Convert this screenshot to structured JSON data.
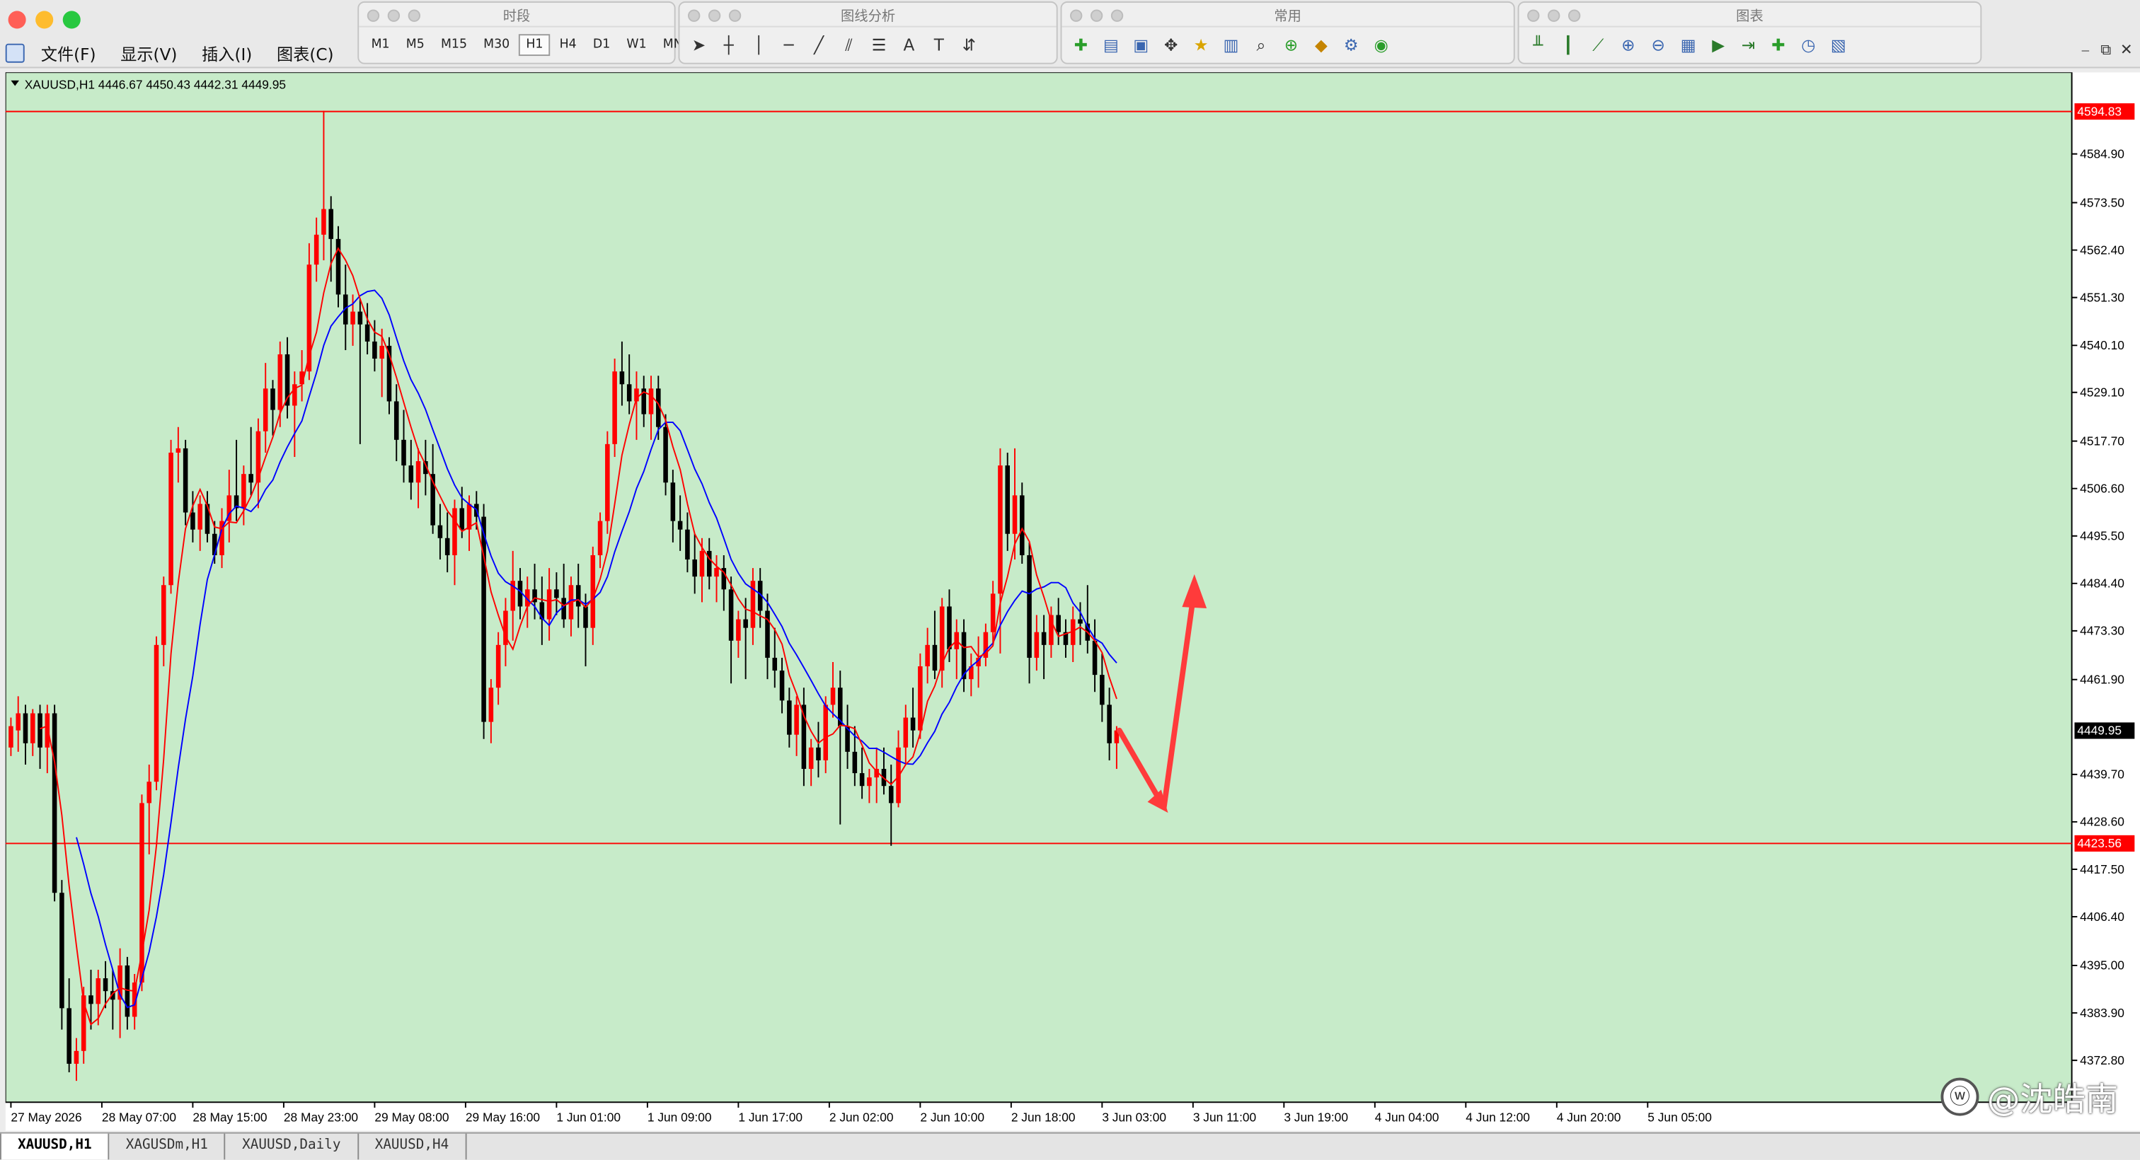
{
  "menu": {
    "items": [
      "文件(F)",
      "显示(V)",
      "插入(I)",
      "图表(C)"
    ]
  },
  "toolbars": {
    "timeframes": {
      "title": "时段",
      "items": [
        "M1",
        "M5",
        "M15",
        "M30",
        "H1",
        "H4",
        "D1",
        "W1",
        "MN"
      ],
      "active": "H1"
    },
    "line_studies": {
      "title": "图线分析"
    },
    "standard": {
      "title": "常用"
    },
    "charts": {
      "title": "图表"
    }
  },
  "window_controls": [
    "⎯",
    "⧉",
    "✕"
  ],
  "tabs": [
    {
      "label": "XAUUSD,H1",
      "active": true
    },
    {
      "label": "XAGUSDm,H1",
      "active": false
    },
    {
      "label": "XAUUSD,Daily",
      "active": false
    },
    {
      "label": "XAUUSD,H4",
      "active": false
    }
  ],
  "watermark": {
    "text": "@沈皓南",
    "icon": "weibo-icon"
  },
  "colors": {
    "background": "#c7ebc9",
    "bull": "#ff0000",
    "bear": "#000000",
    "ma_fast": "#ff0000",
    "ma_slow": "#0000ff",
    "hline": "#ff0000",
    "arrow": "#ff3b3b"
  },
  "chart_data": {
    "type": "candlestick",
    "symbol_header": "XAUUSD,H1  4446.67 4450.43 4442.31 4449.95",
    "current_price": "4449.95",
    "y_range": [
      4363.0,
      4604.0
    ],
    "y_ticks": [
      "4584.90",
      "4573.50",
      "4562.40",
      "4551.30",
      "4540.10",
      "4529.10",
      "4517.70",
      "4506.60",
      "4495.50",
      "4484.40",
      "4473.30",
      "4461.90",
      "4439.70",
      "4428.60",
      "4417.50",
      "4406.40",
      "4395.00",
      "4383.90",
      "4372.80"
    ],
    "x_labels": [
      "27 May 2026",
      "28 May 07:00",
      "28 May 15:00",
      "28 May 23:00",
      "29 May 08:00",
      "29 May 16:00",
      "1 Jun 01:00",
      "1 Jun 09:00",
      "1 Jun 17:00",
      "2 Jun 02:00",
      "2 Jun 10:00",
      "2 Jun 18:00",
      "3 Jun 03:00",
      "3 Jun 11:00",
      "3 Jun 19:00",
      "4 Jun 04:00",
      "4 Jun 12:00",
      "4 Jun 20:00",
      "5 Jun 05:00"
    ],
    "hlines": [
      {
        "price": 4594.83,
        "label": "4594.83"
      },
      {
        "price": 4423.56,
        "label": "4423.56"
      }
    ],
    "ohlc": [
      [
        4446,
        4453,
        4444,
        4451
      ],
      [
        4450,
        4458,
        4445,
        4454
      ],
      [
        4454,
        4456,
        4442,
        4447
      ],
      [
        4447,
        4455,
        4444,
        4454
      ],
      [
        4454,
        4456,
        4441,
        4446
      ],
      [
        4446,
        4456,
        4440,
        4454
      ],
      [
        4454,
        4456,
        4410,
        4412
      ],
      [
        4412,
        4415,
        4380,
        4385
      ],
      [
        4385,
        4392,
        4370,
        4372
      ],
      [
        4372,
        4378,
        4368,
        4375
      ],
      [
        4375,
        4390,
        4372,
        4388
      ],
      [
        4388,
        4394,
        4380,
        4386
      ],
      [
        4386,
        4394,
        4381,
        4392
      ],
      [
        4392,
        4396,
        4385,
        4389
      ],
      [
        4389,
        4394,
        4380,
        4387
      ],
      [
        4387,
        4399,
        4378,
        4395
      ],
      [
        4395,
        4397,
        4380,
        4383
      ],
      [
        4383,
        4393,
        4380,
        4391
      ],
      [
        4391,
        4435,
        4389,
        4433
      ],
      [
        4433,
        4442,
        4421,
        4438
      ],
      [
        4438,
        4472,
        4436,
        4470
      ],
      [
        4470,
        4486,
        4465,
        4484
      ],
      [
        4484,
        4518,
        4482,
        4515
      ],
      [
        4515,
        4521,
        4508,
        4516
      ],
      [
        4516,
        4518,
        4498,
        4501
      ],
      [
        4501,
        4506,
        4494,
        4497
      ],
      [
        4497,
        4505,
        4492,
        4503
      ],
      [
        4503,
        4506,
        4494,
        4496
      ],
      [
        4496,
        4499,
        4489,
        4491
      ],
      [
        4491,
        4502,
        4488,
        4499
      ],
      [
        4499,
        4511,
        4494,
        4505
      ],
      [
        4505,
        4518,
        4499,
        4502
      ],
      [
        4502,
        4512,
        4498,
        4510
      ],
      [
        4510,
        4521,
        4505,
        4508
      ],
      [
        4508,
        4523,
        4502,
        4520
      ],
      [
        4520,
        4536,
        4515,
        4530
      ],
      [
        4530,
        4532,
        4519,
        4525
      ],
      [
        4525,
        4541,
        4521,
        4538
      ],
      [
        4538,
        4542,
        4523,
        4526
      ],
      [
        4526,
        4534,
        4514,
        4531
      ],
      [
        4531,
        4539,
        4527,
        4534
      ],
      [
        4534,
        4564,
        4532,
        4559
      ],
      [
        4559,
        4570,
        4555,
        4566
      ],
      [
        4566,
        4595,
        4560,
        4572
      ],
      [
        4572,
        4575,
        4555,
        4565
      ],
      [
        4565,
        4568,
        4549,
        4552
      ],
      [
        4552,
        4559,
        4539,
        4545
      ],
      [
        4545,
        4552,
        4540,
        4548
      ],
      [
        4548,
        4551,
        4517,
        4545
      ],
      [
        4545,
        4550,
        4538,
        4541
      ],
      [
        4541,
        4546,
        4534,
        4537
      ],
      [
        4537,
        4544,
        4528,
        4540
      ],
      [
        4540,
        4542,
        4524,
        4527
      ],
      [
        4527,
        4531,
        4513,
        4518
      ],
      [
        4518,
        4525,
        4508,
        4512
      ],
      [
        4512,
        4518,
        4504,
        4508
      ],
      [
        4508,
        4516,
        4502,
        4513
      ],
      [
        4513,
        4518,
        4505,
        4510
      ],
      [
        4510,
        4517,
        4496,
        4498
      ],
      [
        4498,
        4503,
        4490,
        4495
      ],
      [
        4495,
        4501,
        4487,
        4491
      ],
      [
        4491,
        4504,
        4484,
        4502
      ],
      [
        4502,
        4507,
        4495,
        4497
      ],
      [
        4497,
        4505,
        4492,
        4503
      ],
      [
        4503,
        4506,
        4497,
        4500
      ],
      [
        4500,
        4503,
        4448,
        4452
      ],
      [
        4452,
        4462,
        4447,
        4460
      ],
      [
        4460,
        4473,
        4456,
        4470
      ],
      [
        4470,
        4481,
        4465,
        4478
      ],
      [
        4478,
        4492,
        4471,
        4485
      ],
      [
        4485,
        4488,
        4476,
        4479
      ],
      [
        4479,
        4486,
        4474,
        4483
      ],
      [
        4483,
        4489,
        4476,
        4480
      ],
      [
        4480,
        4486,
        4470,
        4476
      ],
      [
        4476,
        4488,
        4471,
        4483
      ],
      [
        4483,
        4487,
        4477,
        4481
      ],
      [
        4481,
        4489,
        4474,
        4476
      ],
      [
        4476,
        4486,
        4472,
        4484
      ],
      [
        4484,
        4489,
        4474,
        4479
      ],
      [
        4479,
        4482,
        4465,
        4474
      ],
      [
        4474,
        4493,
        4470,
        4491
      ],
      [
        4491,
        4501,
        4488,
        4499
      ],
      [
        4499,
        4520,
        4496,
        4517
      ],
      [
        4517,
        4537,
        4514,
        4534
      ],
      [
        4534,
        4541,
        4526,
        4531
      ],
      [
        4531,
        4538,
        4524,
        4527
      ],
      [
        4527,
        4534,
        4518,
        4530
      ],
      [
        4530,
        4533,
        4521,
        4524
      ],
      [
        4524,
        4533,
        4518,
        4530
      ],
      [
        4530,
        4533,
        4518,
        4521
      ],
      [
        4521,
        4524,
        4505,
        4508
      ],
      [
        4508,
        4511,
        4494,
        4499
      ],
      [
        4499,
        4505,
        4492,
        4497
      ],
      [
        4497,
        4501,
        4487,
        4490
      ],
      [
        4490,
        4496,
        4482,
        4486
      ],
      [
        4486,
        4495,
        4480,
        4492
      ],
      [
        4492,
        4495,
        4483,
        4486
      ],
      [
        4486,
        4491,
        4480,
        4488
      ],
      [
        4488,
        4491,
        4478,
        4483
      ],
      [
        4483,
        4486,
        4461,
        4471
      ],
      [
        4471,
        4478,
        4467,
        4476
      ],
      [
        4476,
        4481,
        4462,
        4474
      ],
      [
        4474,
        4488,
        4470,
        4485
      ],
      [
        4485,
        4488,
        4474,
        4478
      ],
      [
        4478,
        4482,
        4462,
        4467
      ],
      [
        4467,
        4474,
        4460,
        4464
      ],
      [
        4464,
        4467,
        4454,
        4457
      ],
      [
        4457,
        4460,
        4446,
        4449
      ],
      [
        4449,
        4458,
        4444,
        4456
      ],
      [
        4456,
        4460,
        4437,
        4441
      ],
      [
        4441,
        4448,
        4437,
        4446
      ],
      [
        4446,
        4452,
        4439,
        4443
      ],
      [
        4443,
        4458,
        4440,
        4456
      ],
      [
        4456,
        4466,
        4453,
        4460
      ],
      [
        4460,
        4464,
        4428,
        4451
      ],
      [
        4451,
        4456,
        4441,
        4445
      ],
      [
        4445,
        4451,
        4437,
        4440
      ],
      [
        4440,
        4446,
        4434,
        4437
      ],
      [
        4437,
        4441,
        4433,
        4439
      ],
      [
        4439,
        4446,
        4433,
        4441
      ],
      [
        4441,
        4446,
        4435,
        4437
      ],
      [
        4437,
        4442,
        4423,
        4433
      ],
      [
        4433,
        4450,
        4432,
        4446
      ],
      [
        4446,
        4456,
        4442,
        4453
      ],
      [
        4453,
        4460,
        4446,
        4450
      ],
      [
        4450,
        4468,
        4448,
        4465
      ],
      [
        4465,
        4474,
        4461,
        4470
      ],
      [
        4470,
        4478,
        4462,
        4464
      ],
      [
        4464,
        4481,
        4460,
        4479
      ],
      [
        4479,
        4483,
        4466,
        4469
      ],
      [
        4469,
        4476,
        4462,
        4473
      ],
      [
        4473,
        4476,
        4459,
        4462
      ],
      [
        4462,
        4468,
        4458,
        4465
      ],
      [
        4465,
        4472,
        4460,
        4467
      ],
      [
        4467,
        4475,
        4465,
        4473
      ],
      [
        4473,
        4485,
        4470,
        4482
      ],
      [
        4482,
        4516,
        4468,
        4512
      ],
      [
        4512,
        4515,
        4492,
        4496
      ],
      [
        4496,
        4516,
        4490,
        4505
      ],
      [
        4505,
        4508,
        4489,
        4491
      ],
      [
        4491,
        4494,
        4461,
        4467
      ],
      [
        4467,
        4477,
        4464,
        4473
      ],
      [
        4473,
        4477,
        4462,
        4470
      ],
      [
        4470,
        4479,
        4467,
        4477
      ],
      [
        4477,
        4481,
        4470,
        4473
      ],
      [
        4473,
        4476,
        4467,
        4470
      ],
      [
        4470,
        4479,
        4466,
        4476
      ],
      [
        4476,
        4480,
        4470,
        4475
      ],
      [
        4475,
        4484,
        4468,
        4471
      ],
      [
        4471,
        4476,
        4459,
        4463
      ],
      [
        4463,
        4468,
        4452,
        4456
      ],
      [
        4456,
        4460,
        4443,
        4447
      ],
      [
        4447,
        4451,
        4441,
        4450
      ]
    ],
    "ma_fast_period": 5,
    "ma_slow_period": 10,
    "projection": {
      "down_target": {
        "bar_offset": 6.5,
        "price": 4432
      },
      "up_target": {
        "bar_offset": 10.5,
        "price": 4484
      }
    }
  }
}
